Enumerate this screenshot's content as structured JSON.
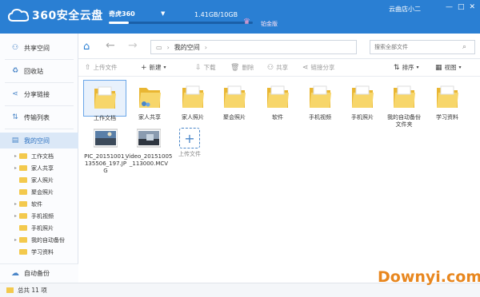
{
  "app": {
    "logo_text": "360安全云盘",
    "user_name": "奇虎360",
    "storage_text": "1.41GB/10GB",
    "storage_used_fraction": 0.141,
    "vip_label": "铂金版",
    "shop_name": "云曲店小二"
  },
  "sidebar": {
    "items": [
      {
        "label": "共享空间",
        "icon": "share-space-icon"
      },
      {
        "label": "回收站",
        "icon": "recycle-icon"
      },
      {
        "label": "分享链接",
        "icon": "link-icon"
      },
      {
        "label": "传输列表",
        "icon": "transfer-icon"
      },
      {
        "label": "我的空间",
        "icon": "space-icon"
      }
    ],
    "tree": [
      "工作文档",
      "家人共享",
      "家人照片",
      "聚会照片",
      "软件",
      "手机视频",
      "手机照片",
      "我的自动备份",
      "学习资料"
    ],
    "auto_backup": "自动备份"
  },
  "nav": {
    "path_root": "我的空间",
    "search_placeholder": "搜索全部文件"
  },
  "toolbar": {
    "upload": "上传文件",
    "new": "新建",
    "download": "下载",
    "delete": "删除",
    "share": "共享",
    "link_share": "链接分享",
    "sort": "排序",
    "view": "视图"
  },
  "files": [
    {
      "label": "工作文档",
      "type": "folder"
    },
    {
      "label": "家人共享",
      "type": "folder-shared"
    },
    {
      "label": "家人照片",
      "type": "folder"
    },
    {
      "label": "聚会照片",
      "type": "folder"
    },
    {
      "label": "软件",
      "type": "folder"
    },
    {
      "label": "手机视频",
      "type": "folder"
    },
    {
      "label": "手机照片",
      "type": "folder"
    },
    {
      "label": "我的自动备份文件夹",
      "type": "folder"
    },
    {
      "label": "学习资料",
      "type": "folder"
    },
    {
      "label": "PIC_20151001_135506_197.JPG",
      "type": "image"
    },
    {
      "label": "Video_20151005_113000.MCV",
      "type": "video"
    },
    {
      "label": "上传文件",
      "type": "upload"
    }
  ],
  "status": {
    "count_text": "总共 11 项"
  },
  "watermark": "Downyi.com",
  "colors": {
    "titlebar": "#2a7fd3",
    "folder": "#f3c94d",
    "accent": "#2a7fd3"
  }
}
